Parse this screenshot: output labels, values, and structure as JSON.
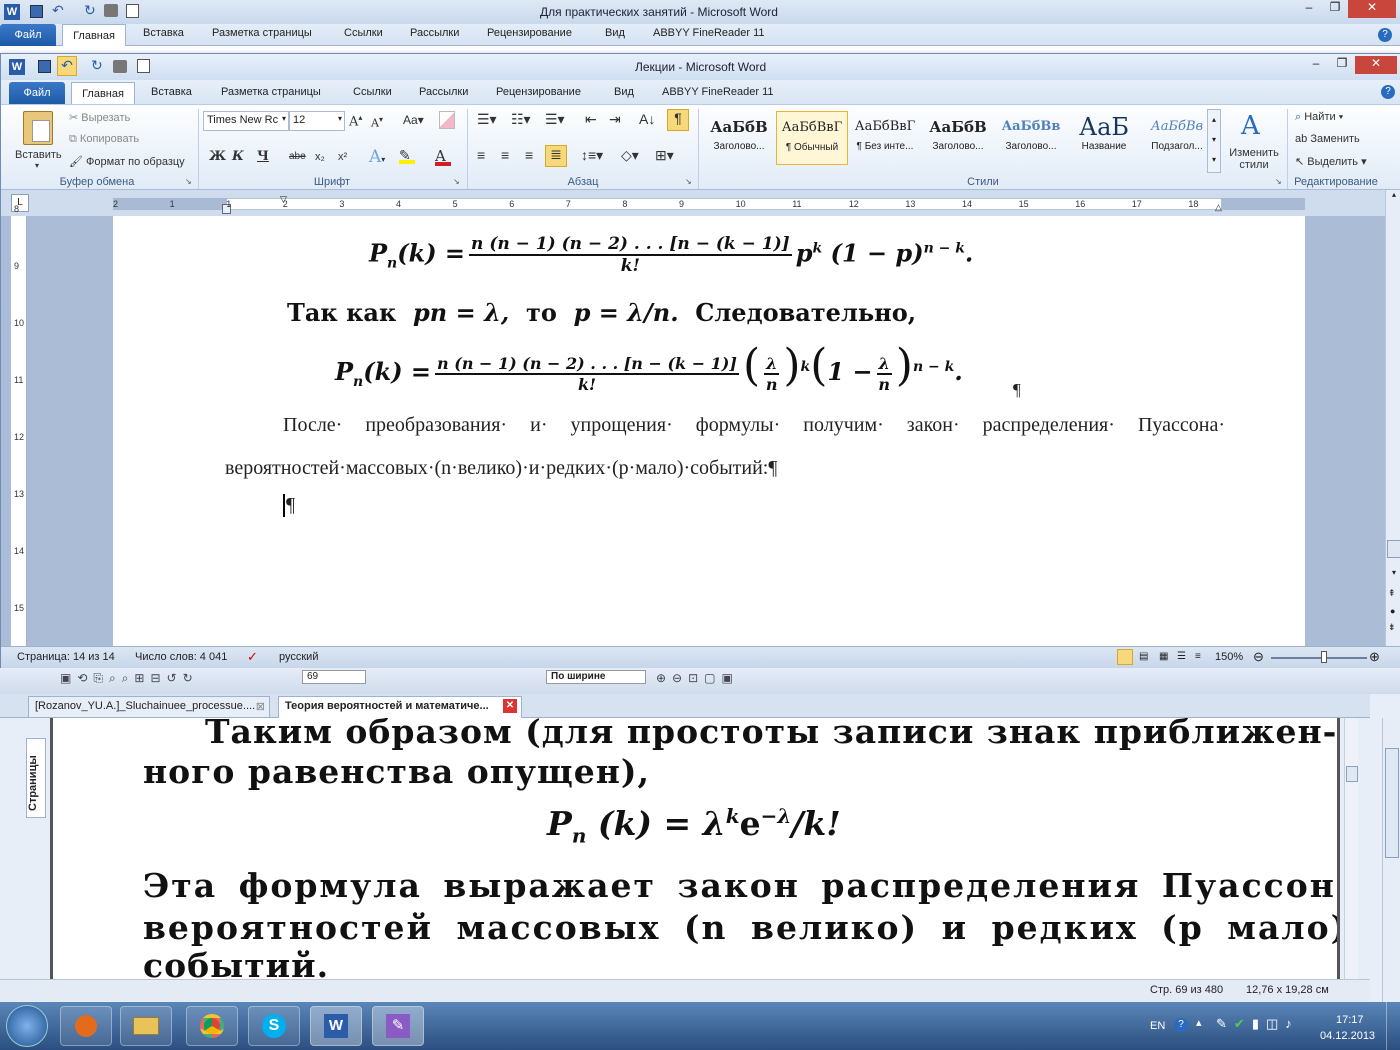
{
  "back_window": {
    "title": "Для практических занятий  -  Microsoft Word",
    "tabs": [
      "Файл",
      "Главная",
      "Вставка",
      "Разметка страницы",
      "Ссылки",
      "Рассылки",
      "Рецензирование",
      "Вид",
      "ABBYY FineReader 11"
    ]
  },
  "front_window": {
    "title": "Лекции  -  Microsoft Word",
    "tabs": [
      "Файл",
      "Главная",
      "Вставка",
      "Разметка страницы",
      "Ссылки",
      "Рассылки",
      "Рецензирование",
      "Вид",
      "ABBYY FineReader 11"
    ],
    "clipboard": {
      "paste": "Вставить",
      "cut": "Вырезать",
      "copy": "Копировать",
      "format_painter": "Формат по образцу",
      "label": "Буфер обмена"
    },
    "font": {
      "name": "Times New Rc",
      "size": "12",
      "label": "Шрифт",
      "bold": "Ж",
      "italic": "К",
      "underline": "Ч",
      "strike": "abe",
      "sub": "x₂",
      "sup": "x²",
      "case": "Aa"
    },
    "paragraph": {
      "label": "Абзац"
    },
    "styles": {
      "label": "Стили",
      "items": [
        {
          "sample": "АаБбВ",
          "name": "Заголово..."
        },
        {
          "sample": "АаБбВвГ",
          "name": "¶ Обычный"
        },
        {
          "sample": "АаБбВвГ",
          "name": "¶ Без инте..."
        },
        {
          "sample": "АаБбВ",
          "name": "Заголово..."
        },
        {
          "sample": "АаБбВв",
          "name": "Заголово..."
        },
        {
          "sample": "АаБ",
          "name": "Название"
        },
        {
          "sample": "АаБбВв",
          "name": "Подзагол..."
        }
      ],
      "change": "Изменить стили"
    },
    "editing": {
      "label": "Редактирование",
      "find": "Найти",
      "replace": "Заменить",
      "select": "Выделить"
    },
    "ruler_numbers": [
      "2",
      "1",
      "1",
      "2",
      "3",
      "4",
      "5",
      "6",
      "7",
      "8",
      "9",
      "10",
      "11",
      "12",
      "13",
      "14",
      "15",
      "16",
      "17",
      "18"
    ],
    "vruler_numbers": [
      "8",
      "9",
      "10",
      "11",
      "12",
      "13",
      "14",
      "15"
    ],
    "document": {
      "line1_text": "Так  как",
      "line1_text2": "то",
      "line1_text3": "Следовательно,",
      "paragraph": "После· преобразования· и· упрощения· формулы· получим· закон· распределения· Пуассона· вероятностей·массовых·(n·велико)·и·редких·(p·мало)·событий:¶",
      "empty_mark": "¶",
      "mark2": "¶"
    },
    "status": {
      "page": "Страница: 14 из 14",
      "words": "Число слов: 4 041",
      "lang": "русский",
      "zoom": "150%"
    }
  },
  "pdf_viewer": {
    "tabs": [
      "[Rozanov_YU.A.]_Sluchainuee_processue....",
      "Теория вероятностей и математиче..."
    ],
    "side_label": "Страницы",
    "zoom_mode": "По ширине",
    "zoom_val": "69",
    "text_line1": "Таким  образом  (для  простоты записи знак приближен-",
    "text_line2": "ного  равенства  опущен),",
    "text_line3": "Эта  формула  выражает  закон  распределения  Пуассона",
    "text_line4": "вероятностей  массовых  (n  велико)  и  редких  (p  мало)",
    "text_line5": "событий.",
    "page_info": "Стр. 69 из 480",
    "size_info": "12,76 x 19,28 см"
  },
  "taskbar": {
    "lang": "EN",
    "time": "17:17",
    "date": "04.12.2013"
  }
}
